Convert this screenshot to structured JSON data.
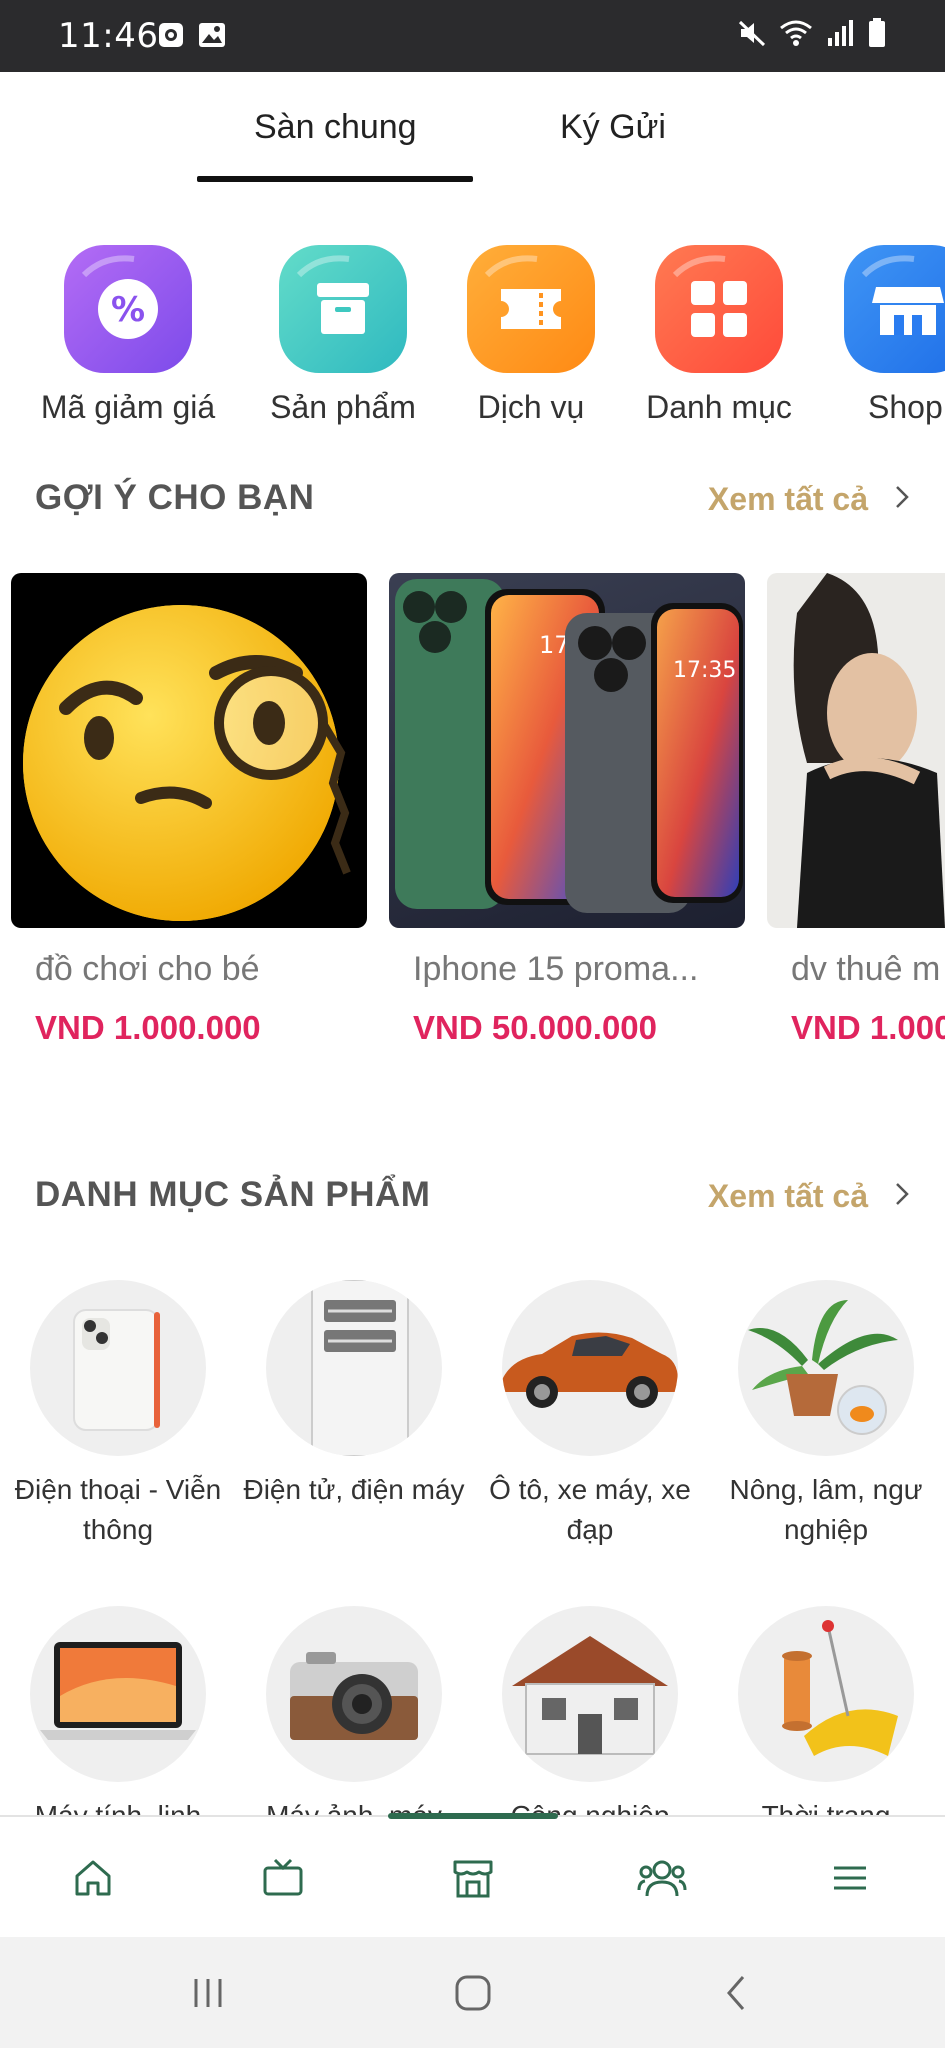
{
  "status_bar": {
    "time": "11:46"
  },
  "tabs": [
    {
      "label": "Sàn chung",
      "active": true
    },
    {
      "label": "Ký Gửi",
      "active": false
    }
  ],
  "quick_actions": [
    {
      "label": "Mã giảm giá",
      "icon": "discount-icon",
      "color": "#9b5cf0"
    },
    {
      "label": "Sản phẩm",
      "icon": "box-icon",
      "color": "#3ec8c0"
    },
    {
      "label": "Dịch vụ",
      "icon": "ticket-icon",
      "color": "#ff9420"
    },
    {
      "label": "Danh mục",
      "icon": "grid-icon",
      "color": "#ff5a3c"
    },
    {
      "label": "Shop",
      "icon": "store-icon",
      "color": "#2a7cf0"
    }
  ],
  "suggest": {
    "title": "GỢI Ý CHO BẠN",
    "more": "Xem tất cả",
    "items": [
      {
        "name": "đồ chơi cho bé",
        "price": "VND 1.000.000"
      },
      {
        "name": "Iphone 15 proma...",
        "price": "VND 50.000.000"
      },
      {
        "name": "dv thuê m",
        "price": "VND 1.000"
      }
    ]
  },
  "categories": {
    "title": "DANH MỤC SẢN PHẨM",
    "more": "Xem tất cả",
    "row1": [
      {
        "label": "Điện thoại - Viễn thông"
      },
      {
        "label": "Điện tử, điện máy"
      },
      {
        "label": "Ô tô, xe máy, xe đạp"
      },
      {
        "label": "Nông, lâm, ngư nghiệp"
      }
    ],
    "row2": [
      {
        "label": "Máy tính, linh"
      },
      {
        "label": "Máy ảnh, máy"
      },
      {
        "label": "Công nghiệp"
      },
      {
        "label": "Thời trang"
      }
    ]
  },
  "colors": {
    "accent_green": "#2e6b4f",
    "price_red": "#e0245e",
    "link_gold": "#c4a56b"
  }
}
